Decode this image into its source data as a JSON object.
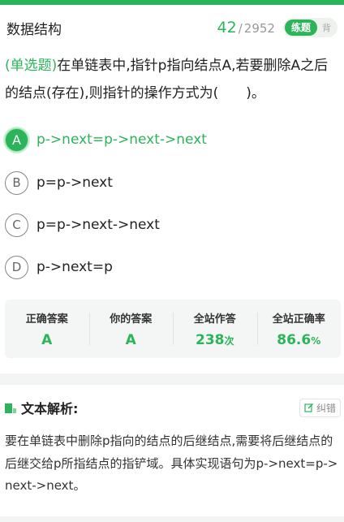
{
  "header": {
    "title": "数据结构",
    "current": "42",
    "separator": "/",
    "total": "2952",
    "mode_active": "练题",
    "mode_inactive": "背"
  },
  "question": {
    "type_label": "(单选题)",
    "text": "在单链表中,指针p指向结点A,若要删除A之后的结点(存在),则指针的操作方式为(　　)。"
  },
  "options": [
    {
      "letter": "A",
      "text": "p->next=p->next->next",
      "state": "correct"
    },
    {
      "letter": "B",
      "text": "p=p->next",
      "state": "normal"
    },
    {
      "letter": "C",
      "text": "p=p->next->next",
      "state": "normal"
    },
    {
      "letter": "D",
      "text": "p->next=p",
      "state": "normal"
    }
  ],
  "stats": {
    "correct_answer_label": "正确答案",
    "correct_answer_value": "A",
    "your_answer_label": "你的答案",
    "your_answer_value": "A",
    "attempts_label": "全站作答",
    "attempts_value": "238",
    "attempts_unit": "次",
    "accuracy_label": "全站正确率",
    "accuracy_value": "86.6",
    "accuracy_unit": "%"
  },
  "analysis": {
    "title": "文本解析:",
    "report_label": "纠错",
    "body": "要在单链表中删除p指向的结点的后继结点,需要将后继结点的后继交给p所指结点的指铲域。具体实现语句为p->next=p->next->next。"
  },
  "colors": {
    "accent": "#2cb45a",
    "text": "#222222",
    "muted": "#999999"
  }
}
